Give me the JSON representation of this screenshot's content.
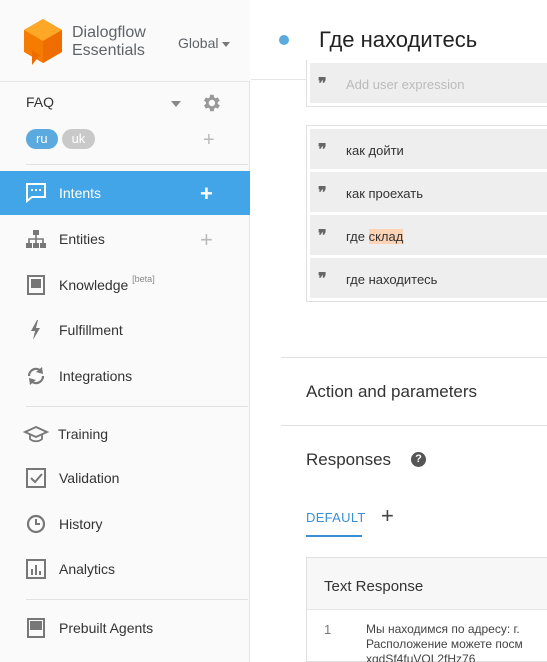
{
  "brand": {
    "line1": "Dialogflow",
    "line2": "Essentials",
    "region": "Global"
  },
  "agent": {
    "name": "FAQ"
  },
  "languages": [
    "ru",
    "uk"
  ],
  "nav": {
    "intents": "Intents",
    "entities": "Entities",
    "knowledge": "Knowledge",
    "knowledge_badge": "[beta]",
    "fulfillment": "Fulfillment",
    "integrations": "Integrations",
    "training": "Training",
    "validation": "Validation",
    "history": "History",
    "analytics": "Analytics",
    "prebuilt": "Prebuilt Agents"
  },
  "intent": {
    "title": "Где находитесь"
  },
  "training_phrases": {
    "placeholder": "Add user expression",
    "items": [
      {
        "pre": "как дойти",
        "highlight": "",
        "post": ""
      },
      {
        "pre": "как проехать",
        "highlight": "",
        "post": ""
      },
      {
        "pre": "где ",
        "highlight": "склад",
        "post": ""
      },
      {
        "pre": "где находитесь",
        "highlight": "",
        "post": ""
      }
    ]
  },
  "sections": {
    "action": "Action and parameters",
    "responses": "Responses"
  },
  "responses": {
    "tab_default": "DEFAULT",
    "card_title": "Text Response",
    "row_number": "1",
    "row_lines": [
      "Мы находимся по адресу: г.",
      "Расположение можете посм",
      "xqdSf4fuVOL2fHz76"
    ]
  },
  "colors": {
    "accent": "#42a5e8",
    "highlight": "#fcd3b5",
    "logo": "#f57c00"
  }
}
